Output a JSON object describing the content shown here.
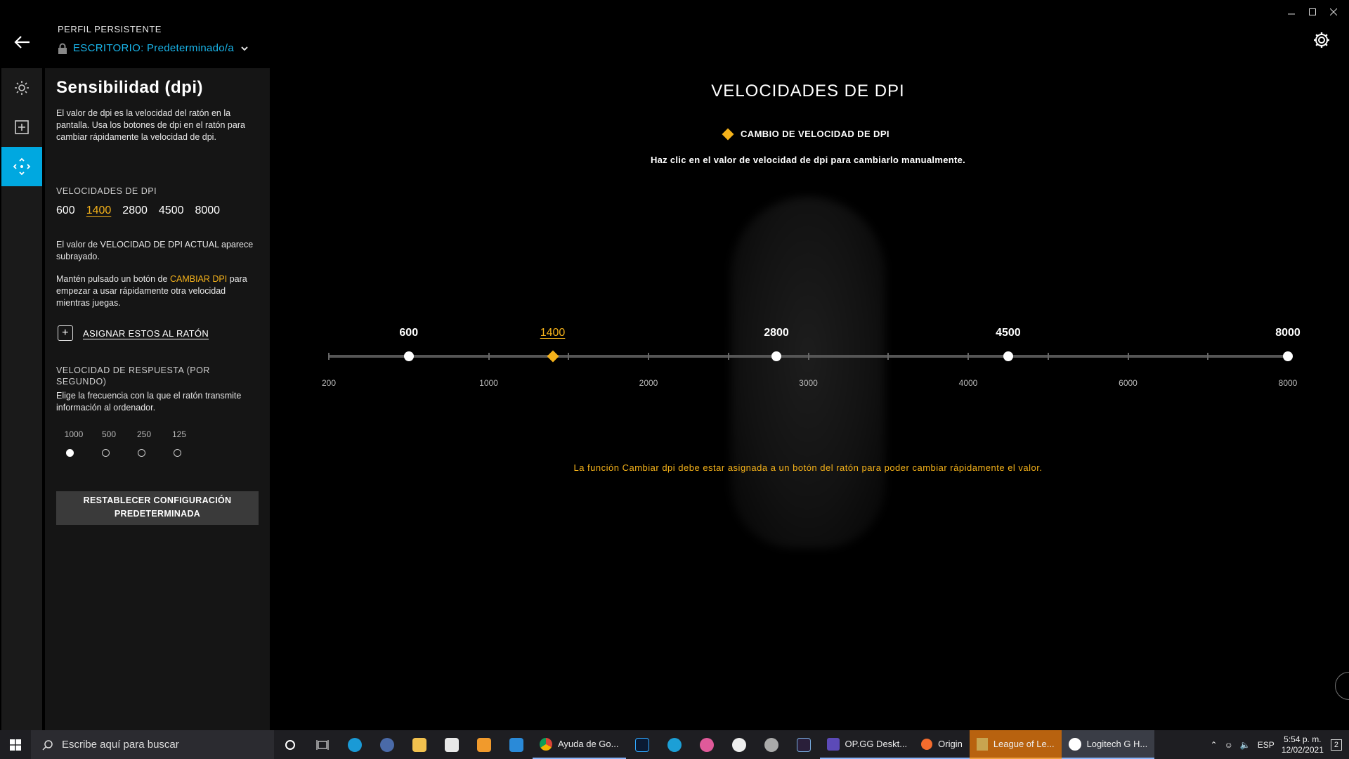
{
  "header": {
    "profile_label": "PERFIL PERSISTENTE",
    "profile_value": "ESCRITORIO: Predeterminado/a"
  },
  "panel": {
    "title": "Sensibilidad (dpi)",
    "description": "El valor de dpi es la velocidad del ratón en la pantalla. Usa los botones de dpi en el ratón para cambiar rápidamente la velocidad de dpi.",
    "dpi_heading": "VELOCIDADES DE DPI",
    "dpi_values": [
      "600",
      "1400",
      "2800",
      "4500",
      "8000"
    ],
    "current_note": "El valor de VELOCIDAD DE DPI ACTUAL aparece subrayado.",
    "hold_pre": "Mantén pulsado un botón de",
    "hold_highlight": "CAMBIAR DPI",
    "hold_post": "para empezar a usar rápidamente otra velocidad mientras juegas.",
    "assign_label": "ASIGNAR ESTOS AL RATÓN",
    "response_heading": "VELOCIDAD DE RESPUESTA (POR SEGUNDO)",
    "response_desc": "Elige la frecuencia con la que el ratón transmite información al ordenador.",
    "rates": [
      "1000",
      "500",
      "250",
      "125"
    ],
    "selected_rate": "1000",
    "reset_label": "RESTABLECER CONFIGURACIÓN PREDETERMINADA"
  },
  "main": {
    "title": "VELOCIDADES DE DPI",
    "legend": "CAMBIO DE VELOCIDAD DE DPI",
    "hint": "Haz clic en el valor de velocidad de dpi para cambiarlo manualmente.",
    "stops": [
      {
        "label": "600",
        "value": 600,
        "current": false
      },
      {
        "label": "1400",
        "value": 1400,
        "current": true
      },
      {
        "label": "2800",
        "value": 2800,
        "current": false
      },
      {
        "label": "4500",
        "value": 4500,
        "current": false
      },
      {
        "label": "8000",
        "value": 8000,
        "current": false
      }
    ],
    "scale_labels": [
      "200",
      "1000",
      "2000",
      "3000",
      "4000",
      "6000",
      "8000"
    ],
    "warning": "La función Cambiar dpi debe estar asignada a un botón del ratón para poder cambiar rápidamente el valor."
  },
  "taskbar": {
    "search_placeholder": "Escribe aquí para buscar",
    "apps": [
      {
        "label": "Ayuda de Go..."
      },
      {
        "label": "OP.GG Deskt..."
      },
      {
        "label": "Origin"
      },
      {
        "label": "League of Le..."
      },
      {
        "label": "Logitech G H..."
      }
    ],
    "lang": "ESP",
    "time": "5:54 p. m.",
    "date": "12/02/2021",
    "notif_count": "2"
  },
  "colors": {
    "accent": "#00a8e0",
    "highlight": "#f5b21a"
  }
}
